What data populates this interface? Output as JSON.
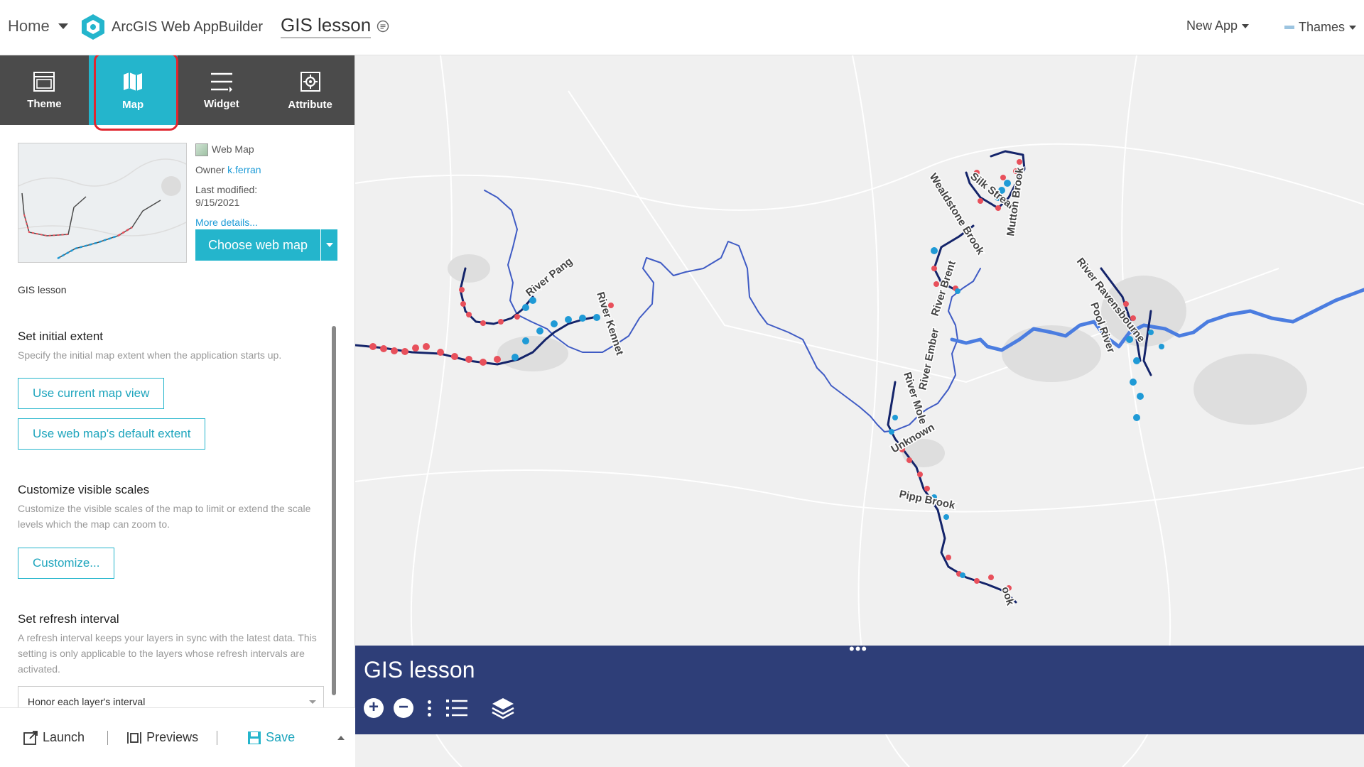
{
  "header": {
    "home_label": "Home",
    "brand": "ArcGIS Web AppBuilder",
    "app_title": "GIS lesson",
    "new_app_label": "New App",
    "theme_label": "Thames"
  },
  "tabs": [
    {
      "label": "Theme",
      "icon": "theme-icon"
    },
    {
      "label": "Map",
      "icon": "map-icon",
      "active": true
    },
    {
      "label": "Widget",
      "icon": "widget-icon"
    },
    {
      "label": "Attribute",
      "icon": "attribute-icon"
    }
  ],
  "webmap": {
    "type_label": "Web Map",
    "owner_label": "Owner",
    "owner": "k.ferran",
    "modified_label": "Last modified:",
    "modified": "9/15/2021",
    "more_details": "More details...",
    "choose_button": "Choose web map",
    "name": "GIS lesson"
  },
  "extent": {
    "heading": "Set initial extent",
    "desc": "Specify the initial map extent when the application starts up.",
    "current_view_button": "Use current map view",
    "default_extent_button": "Use web map's default extent"
  },
  "scales": {
    "heading": "Customize visible scales",
    "desc": "Customize the visible scales of the map to limit or extend the scale levels which the map can zoom to.",
    "button": "Customize..."
  },
  "refresh": {
    "heading": "Set refresh interval",
    "desc": "A refresh interval keeps your layers in sync with the latest data. This setting is only applicable to the layers whose refresh intervals are activated.",
    "select_value": "Honor each layer's interval"
  },
  "footer": {
    "launch": "Launch",
    "previews": "Previews",
    "save": "Save"
  },
  "map": {
    "panel_title": "GIS lesson",
    "river_labels": [
      "River Pang",
      "River Kennet",
      "Silk Stream",
      "Wealdstone Brook",
      "Mutton Brook",
      "River Brent",
      "River Ravensbourne",
      "Pool River",
      "River Ember",
      "River Mole",
      "Unknown",
      "Pipp Brook",
      "ook"
    ],
    "colors": {
      "accent": "#24b5cc",
      "panel": "#2e3e78",
      "river": "#3f5bc4",
      "dot_red": "#e8505b",
      "dot_blue": "#1f9ad6"
    }
  }
}
